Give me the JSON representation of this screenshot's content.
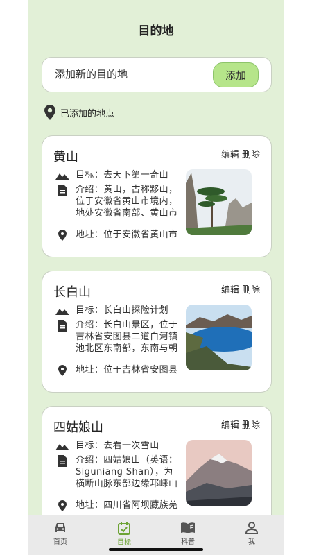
{
  "header": {
    "title": "目的地"
  },
  "add_bar": {
    "placeholder": "添加新的目的地",
    "button_label": "添加"
  },
  "section": {
    "label": "已添加的地点"
  },
  "cards": [
    {
      "name": "黄山",
      "edit": "编辑",
      "delete": "删除",
      "goal": "目标：去天下第一奇山",
      "intro": "介绍：黄山，古称黟山，位于安徽省黄山市境内，地处安徽省南部、黄山市",
      "address": "地址：位于安徽省黄山市"
    },
    {
      "name": "长白山",
      "edit": "编辑",
      "delete": "删除",
      "goal": "目标：长白山探险计划",
      "intro": "介绍：长白山景区，位于吉林省安图县二道白河镇池北区东南部，东南与朝",
      "address": "地址：位于吉林省安图县"
    },
    {
      "name": "四姑娘山",
      "edit": "编辑",
      "delete": "删除",
      "goal": "目标：去看一次雪山",
      "intro": "介绍：四姑娘山（英语：Siguniang Shan），为横断山脉东部边缘邛崃山",
      "address": "地址：四川省阿坝藏族羌"
    }
  ],
  "nav": [
    {
      "label": "首页",
      "icon": "car-icon",
      "active": false
    },
    {
      "label": "目标",
      "icon": "calendar-check-icon",
      "active": true
    },
    {
      "label": "科普",
      "icon": "book-icon",
      "active": false
    },
    {
      "label": "我",
      "icon": "person-icon",
      "active": false
    }
  ],
  "colors": {
    "background": "#e2f0d7",
    "accent": "#6da335",
    "button": "#b6e58a"
  }
}
